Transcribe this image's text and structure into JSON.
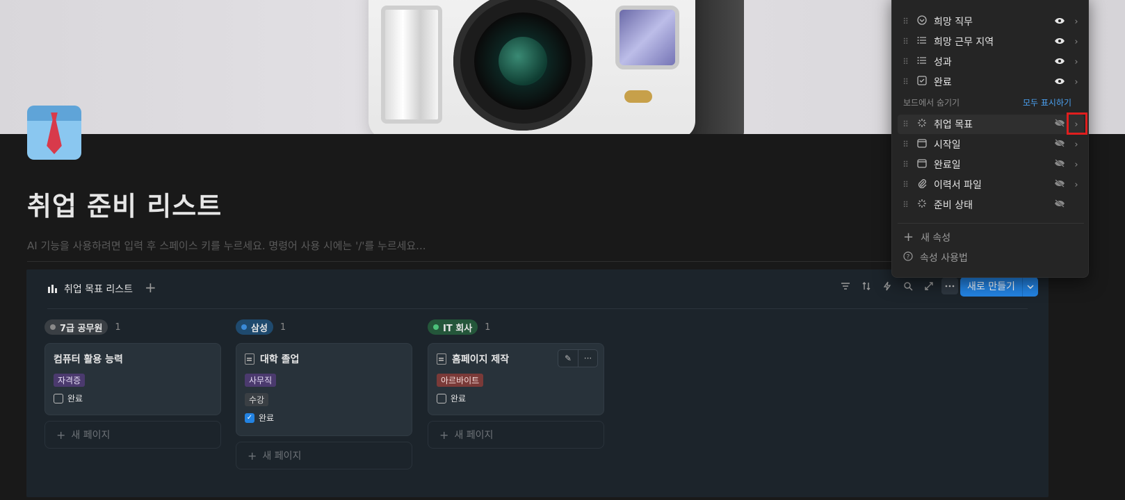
{
  "page": {
    "title": "취업 준비 리스트",
    "ai_hint": "AI 기능을 사용하려면 입력 후 스페이스 키를 누르세요. 명령어 사용 시에는 '/'를 누르세요..."
  },
  "board": {
    "view_name": "취업 목표 리스트",
    "add_view": "+",
    "new_button": "새로 만들기",
    "columns": [
      {
        "group": "7급 공무원",
        "count": "1",
        "color": "#3a3f44",
        "dot": "#8a8a8a",
        "card": {
          "title": "컴퓨터 활용 능력",
          "tags": [
            "자격증"
          ],
          "check_label": "완료",
          "checked": false
        },
        "new_page": "새 페이지"
      },
      {
        "group": "삼성",
        "count": "1",
        "color": "#1f4a6e",
        "dot": "#3a8ad8",
        "card": {
          "title": "대학 졸업",
          "tags": [
            "사무직",
            "수강"
          ],
          "check_label": "완료",
          "checked": true
        },
        "new_page": "새 페이지"
      },
      {
        "group": "IT 회사",
        "count": "1",
        "color": "#24563a",
        "dot": "#4cc07a",
        "card": {
          "title": "홈페이지 제작",
          "tags": [
            "아르바이트"
          ],
          "check_label": "완료",
          "checked": false
        },
        "new_page": "새 페이지"
      }
    ]
  },
  "property_menu": {
    "visible_props": [
      {
        "label": "희망 직무",
        "icon": "select-icon"
      },
      {
        "label": "희망 근무 지역",
        "icon": "list-icon"
      },
      {
        "label": "성과",
        "icon": "list-icon"
      },
      {
        "label": "완료",
        "icon": "checkbox-icon"
      }
    ],
    "hidden_section": "보드에서 숨기기",
    "show_all": "모두 표시하기",
    "hidden_props": [
      {
        "label": "취업 목표",
        "icon": "status-icon"
      },
      {
        "label": "시작일",
        "icon": "calendar-icon"
      },
      {
        "label": "완료일",
        "icon": "calendar-icon"
      },
      {
        "label": "이력서 파일",
        "icon": "paperclip-icon"
      },
      {
        "label": "준비 상태",
        "icon": "status-icon"
      }
    ],
    "new_property": "새 속성",
    "help": "속성 사용법"
  }
}
